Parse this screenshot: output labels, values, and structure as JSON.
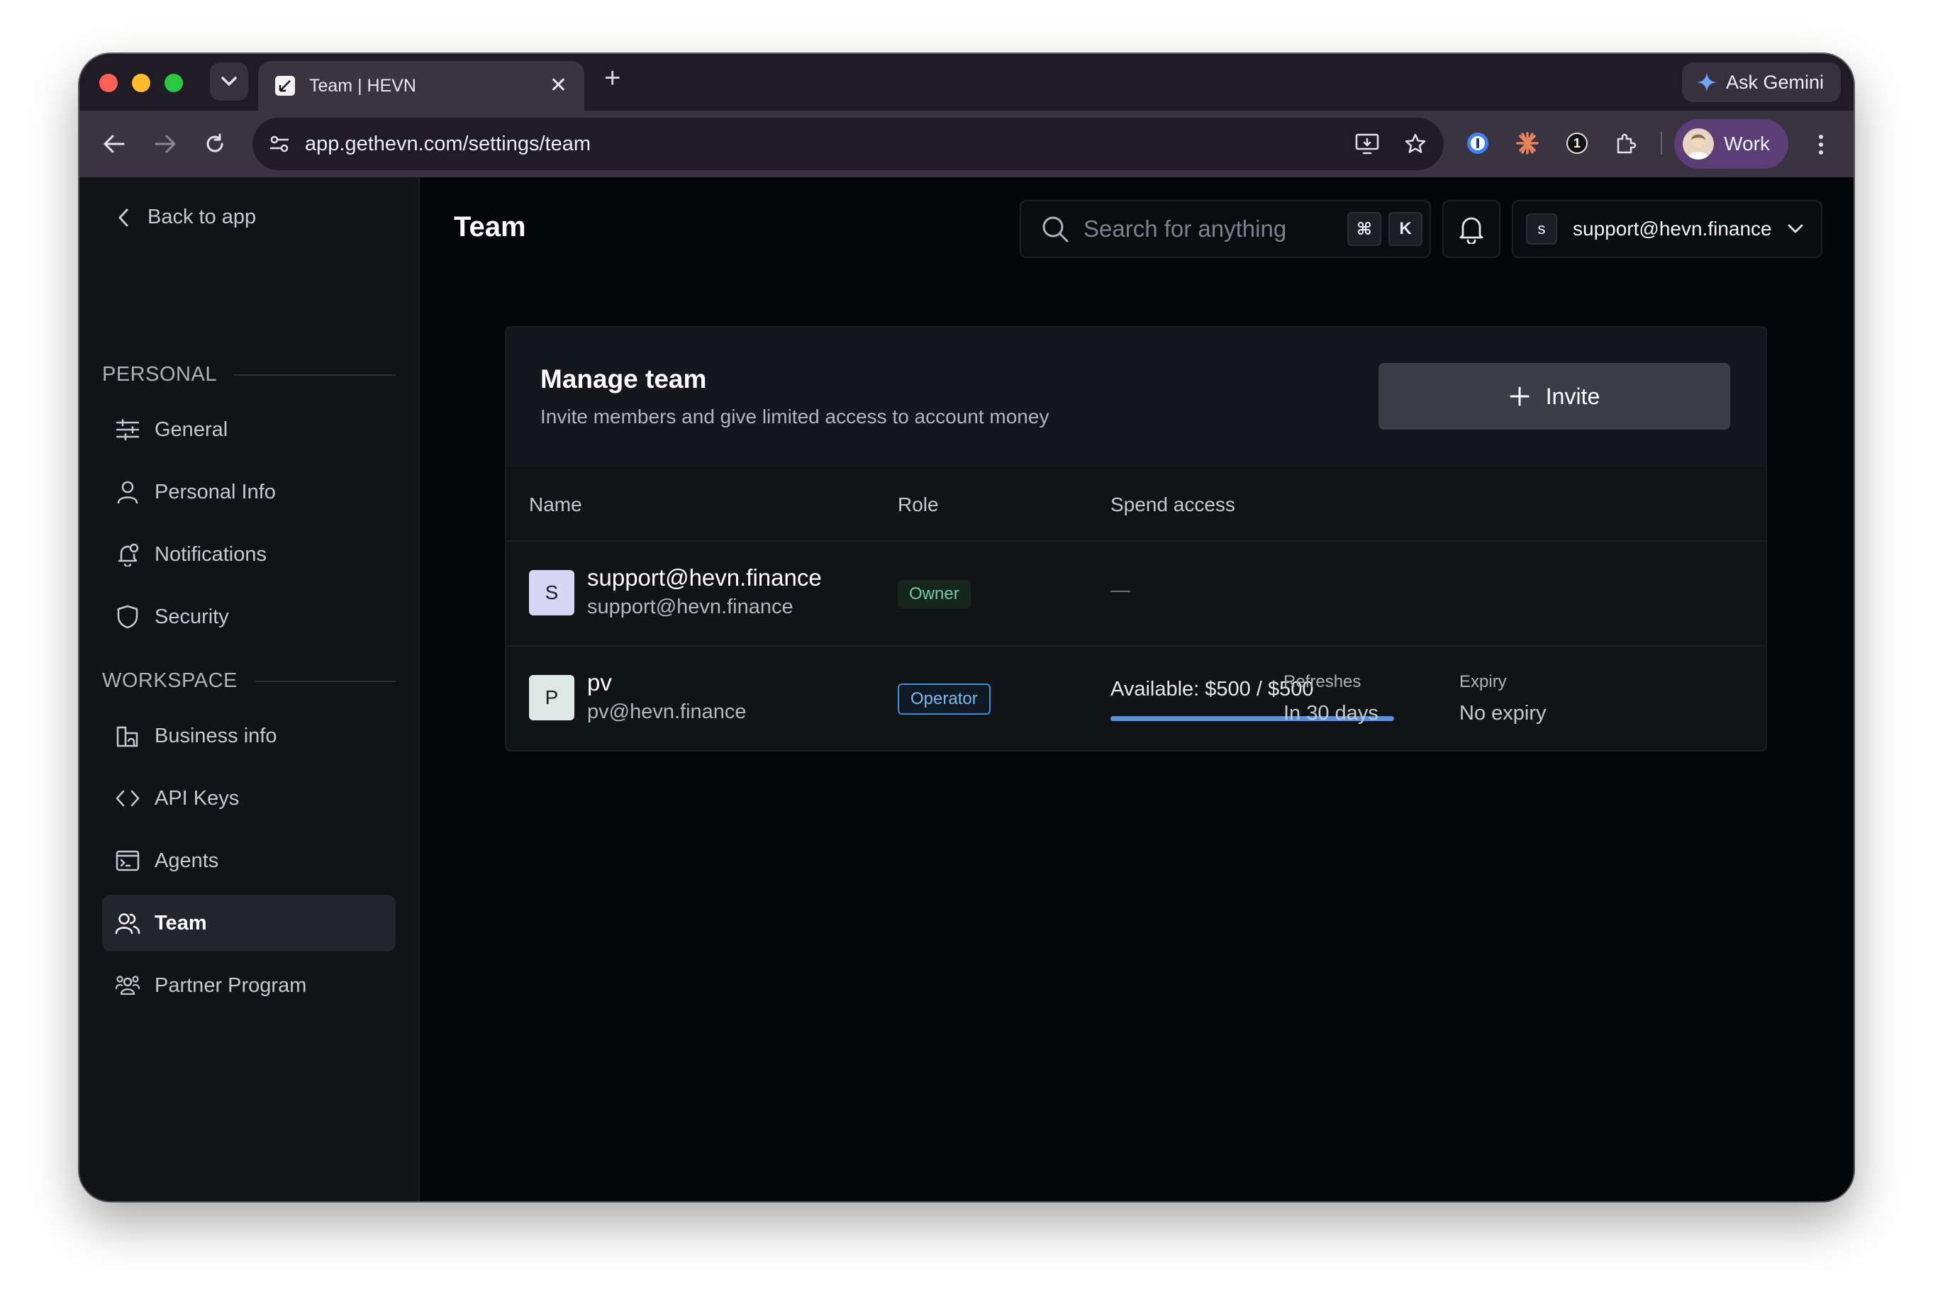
{
  "browser": {
    "tab_title": "Team | HEVN",
    "url": "app.gethevn.com/settings/team",
    "ask_gemini": "Ask Gemini",
    "profile_name": "Work",
    "extension_badge": "1"
  },
  "sidebar": {
    "back_label": "Back to app",
    "personal_label": "PERSONAL",
    "workspace_label": "WORKSPACE",
    "personal_items": [
      {
        "label": "General",
        "icon": "sliders-icon"
      },
      {
        "label": "Personal Info",
        "icon": "user-icon"
      },
      {
        "label": "Notifications",
        "icon": "bell-icon"
      },
      {
        "label": "Security",
        "icon": "shield-icon"
      }
    ],
    "workspace_items": [
      {
        "label": "Business info",
        "icon": "building-icon"
      },
      {
        "label": "API Keys",
        "icon": "code-icon"
      },
      {
        "label": "Agents",
        "icon": "terminal-icon"
      },
      {
        "label": "Team",
        "icon": "users-icon",
        "active": true
      },
      {
        "label": "Partner Program",
        "icon": "partners-icon"
      }
    ]
  },
  "header": {
    "title": "Team",
    "search_placeholder": "Search for anything",
    "shortcut_mod": "⌘",
    "shortcut_key": "K",
    "account_initial": "s",
    "account_email": "support@hevn.finance"
  },
  "manage": {
    "title": "Manage team",
    "subtitle": "Invite members and give limited access to account money",
    "invite_label": "Invite"
  },
  "table": {
    "columns": [
      "Name",
      "Role",
      "Spend access"
    ],
    "rows": [
      {
        "initial": "S",
        "avatar_color": "#d9d6f5",
        "name": "support@hevn.finance",
        "email": "support@hevn.finance",
        "role": "Owner",
        "spend": "—"
      },
      {
        "initial": "P",
        "avatar_color": "#dce8e3",
        "name": "pv",
        "email": "pv@hevn.finance",
        "role": "Operator",
        "available": "Available: $500 / $500",
        "available_fraction": 1.0,
        "refreshes_label": "Refreshes",
        "refreshes_value": "In 30 days",
        "expiry_label": "Expiry",
        "expiry_value": "No expiry"
      }
    ]
  }
}
